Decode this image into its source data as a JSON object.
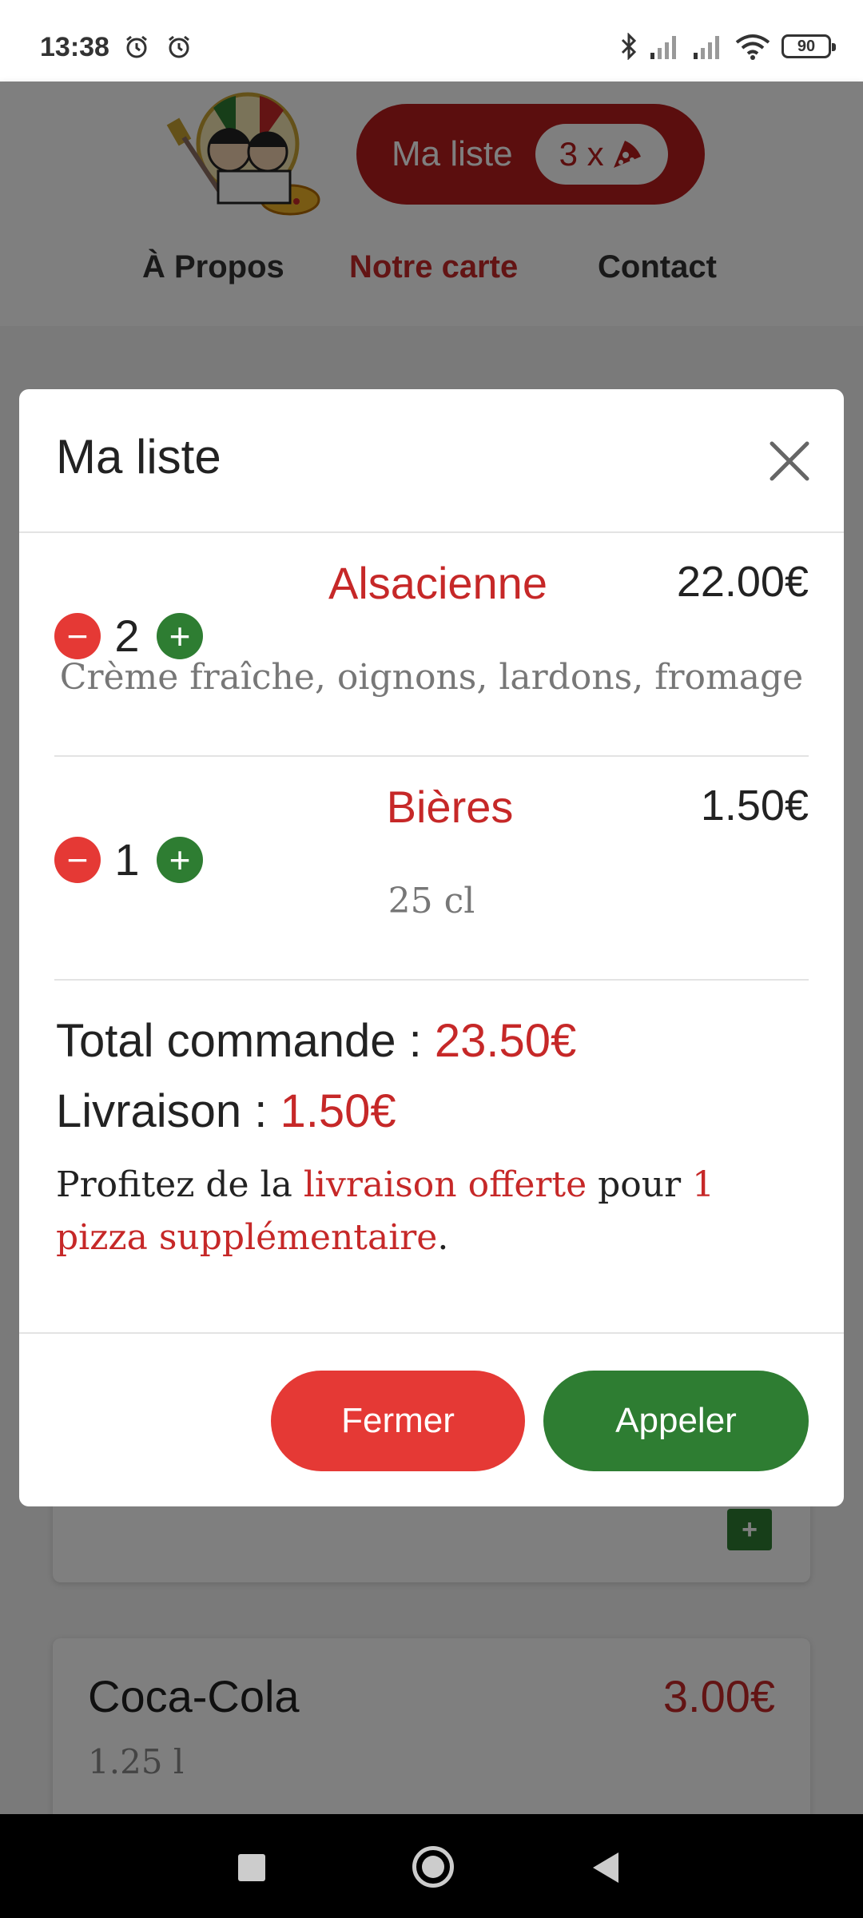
{
  "status_bar": {
    "time": "13:38",
    "battery": "90"
  },
  "header": {
    "cart_label": "Ma liste",
    "cart_count": "3 x",
    "nav": [
      "À Propos",
      "Notre carte",
      "Contact"
    ]
  },
  "background": {
    "card2_title": "Coca-Cola",
    "card2_price": "3.00€",
    "card2_desc": "1.25 l"
  },
  "modal": {
    "title": "Ma liste",
    "items": [
      {
        "qty": "2",
        "name": "Alsacienne",
        "price": "22.00€",
        "desc": "Crème fraîche, oignons, lardons, fromage"
      },
      {
        "qty": "1",
        "name": "Bières",
        "price": "1.50€",
        "desc": "25 cl"
      }
    ],
    "total_label": "Total commande : ",
    "total_value": "23.50€",
    "delivery_label": "Livraison : ",
    "delivery_value": "1.50€",
    "promo_prefix": "Profitez de la ",
    "promo_highlight1": "livraison offerte",
    "promo_middle": " pour ",
    "promo_highlight2": "1 pizza supplémentaire",
    "promo_suffix": ".",
    "close_label": "Fermer",
    "call_label": "Appeler"
  },
  "colors": {
    "accent_red": "#c62828",
    "button_red": "#e53935",
    "button_green": "#2e7d32",
    "header_button": "#b71c1c"
  }
}
